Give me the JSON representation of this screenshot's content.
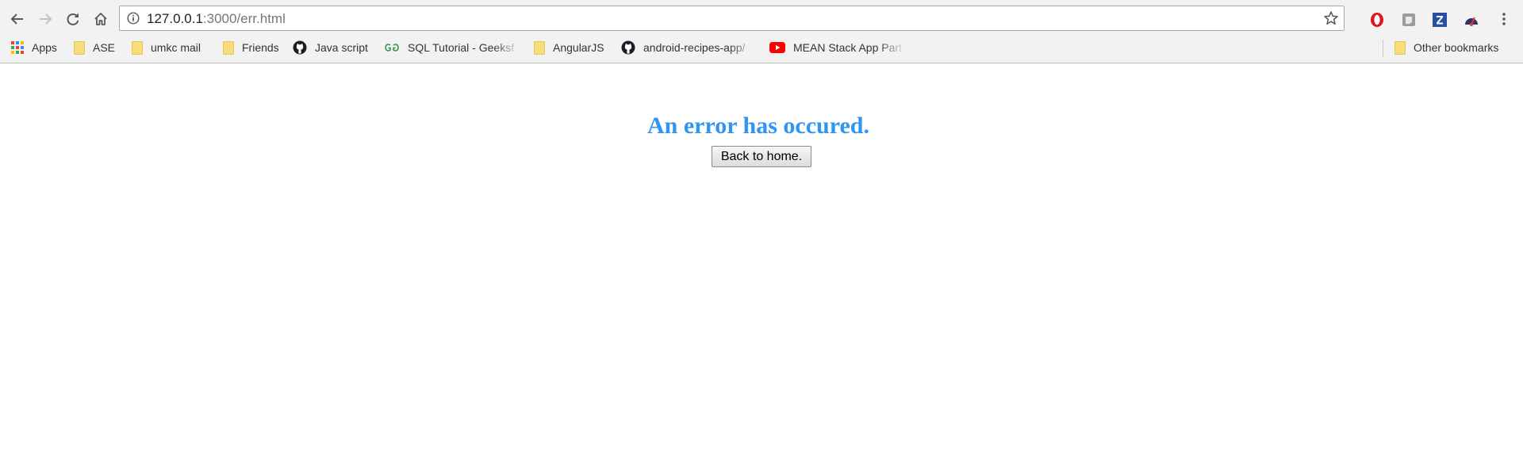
{
  "browser": {
    "url_host": "127.0.0.1",
    "url_rest": ":3000/err.html"
  },
  "bookmarks": [
    {
      "label": "Apps",
      "icon": "apps-grid-icon"
    },
    {
      "label": "ASE",
      "icon": "folder-icon"
    },
    {
      "label": "umkc mail",
      "icon": "folder-icon"
    },
    {
      "label": "Friends",
      "icon": "folder-icon"
    },
    {
      "label": "Java script",
      "icon": "github-icon"
    },
    {
      "label": "SQL Tutorial - Geeksf",
      "icon": "geeksforgeeks-icon"
    },
    {
      "label": "AngularJS",
      "icon": "folder-icon"
    },
    {
      "label": "android-recipes-app/",
      "icon": "github-icon"
    },
    {
      "label": "MEAN Stack App Part",
      "icon": "youtube-icon"
    },
    {
      "label": "Other bookmarks",
      "icon": "folder-icon"
    }
  ],
  "extensions": [
    "opera-icon",
    "extension-gray-icon",
    "z-extension-icon",
    "speedometer-icon"
  ],
  "page": {
    "heading": "An error has occured.",
    "button_label": "Back to home."
  },
  "colors": {
    "heading": "#2e95f2",
    "chrome_bg": "#f2f2f2"
  }
}
